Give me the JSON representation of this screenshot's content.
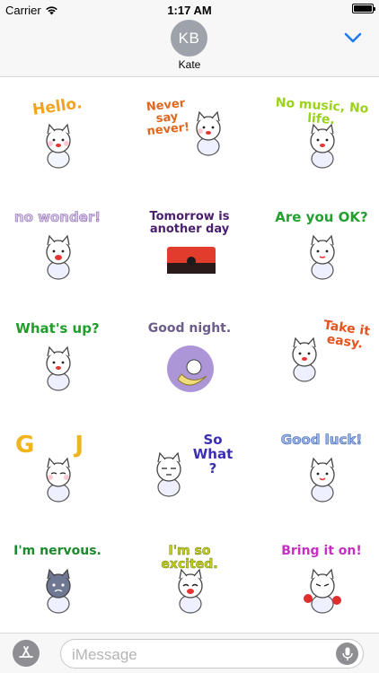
{
  "status_bar": {
    "carrier": "Carrier",
    "time": "1:17 AM"
  },
  "header": {
    "avatar_initials": "KB",
    "contact_name": "Kate"
  },
  "stickers": [
    {
      "text": "Hello.",
      "color": "#f2a51c"
    },
    {
      "text": "Never say never!",
      "color": "#e0671e"
    },
    {
      "text": "No music, No life.",
      "color": "#9bd21a"
    },
    {
      "text": "no wonder!",
      "color": "#d9c6ee"
    },
    {
      "text": "Tomorrow is another day",
      "color": "#4a1f6e"
    },
    {
      "text": "Are you OK?",
      "color": "#23a030"
    },
    {
      "text": "What's up?",
      "color": "#1f9e2c"
    },
    {
      "text": "Good night.",
      "color": "#6b5c8a"
    },
    {
      "text": "Take it easy.",
      "color": "#e4541f"
    },
    {
      "text": "G J",
      "color": "#f0b41c"
    },
    {
      "text": "So What ?",
      "color": "#3a2fb0"
    },
    {
      "text": "Good luck!",
      "color": "#9ab7ec"
    },
    {
      "text": "I'm nervous.",
      "color": "#1c8a2c"
    },
    {
      "text": "I'm so excited.",
      "color": "#c5d21a"
    },
    {
      "text": "Bring it on!",
      "color": "#c42fc2"
    }
  ],
  "compose": {
    "placeholder": "iMessage"
  }
}
